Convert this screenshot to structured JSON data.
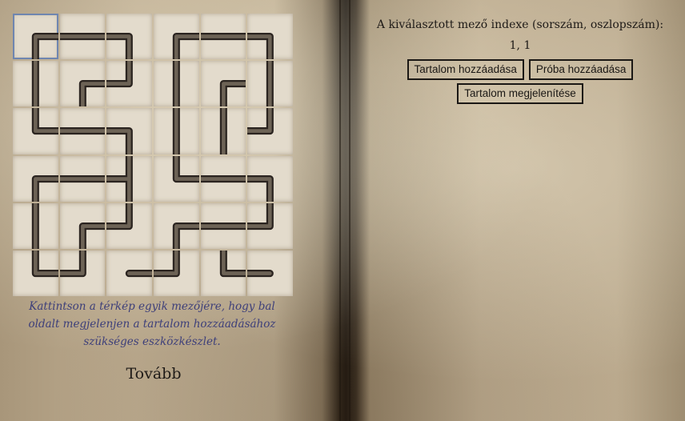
{
  "right": {
    "index_label": "A kiválasztott mező indexe (sorszám, oszlopszám):",
    "index_value": "1, 1",
    "buttons": {
      "add_content": "Tartalom hozzáadása",
      "add_test": "Próba hozzáadása",
      "show_content": "Tartalom megjelenítése"
    }
  },
  "left": {
    "hint": "Kattintson a térkép egyik mezőjére, hogy bal oldalt megjelenjen a tartalom hozzáadásához szükséges eszközkészlet.",
    "next_label": "Tovább"
  },
  "maze": {
    "rows": 6,
    "cols": 6,
    "selected": [
      1,
      1
    ]
  },
  "colors": {
    "selected_outline": "#6f86b0",
    "hint_text": "#3d3f7a",
    "path_dark": "#2b2420"
  }
}
